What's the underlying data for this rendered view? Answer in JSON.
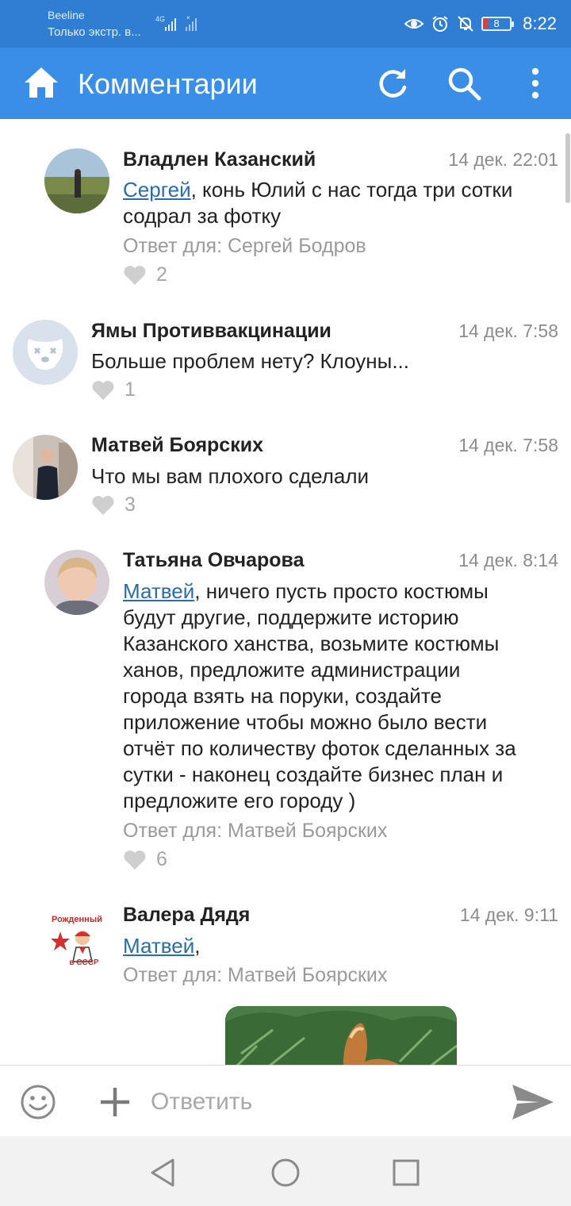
{
  "status_bar": {
    "carrier": "Beeline",
    "carrier_sub": "Только экстр. в...",
    "network_type": "4G",
    "battery": "8",
    "time": "8:22",
    "icons": [
      "eye-icon",
      "alarm-icon",
      "bell-off-icon",
      "battery-icon"
    ]
  },
  "app_bar": {
    "title": "Комментарии",
    "icons": [
      "home-icon",
      "refresh-icon",
      "search-icon",
      "more-icon"
    ],
    "color": "#3a8ee6"
  },
  "comments": [
    {
      "author": "Владлен Казанский",
      "date": "14 дек. 22:01",
      "mention": "Сергей",
      "text_lines": [
        ", конь Юлий с нас тогда три сотки",
        "содрал за фотку"
      ],
      "reply_to": "Ответ для: Сергей Бодров",
      "likes": "2"
    },
    {
      "author": "Ямы Противвакцинации",
      "date": "14 дек. 7:58",
      "text_lines": [
        "Больше проблем нету? Клоуны..."
      ],
      "likes": "1"
    },
    {
      "author": "Матвей Боярских",
      "date": "14 дек. 7:58",
      "text_lines": [
        "Что мы вам плохого сделали"
      ],
      "likes": "3"
    },
    {
      "author": "Татьяна Овчарова",
      "date": "14 дек. 8:14",
      "mention": "Матвей",
      "text_lines": [
        ", ничего пусть просто костюмы",
        "будут другие, поддержите историю",
        "Казанского ханства, возьмите костюмы",
        "ханов, предложите администрации",
        "города взять на поруки, создайте",
        "приложение чтобы можно было вести",
        "отчёт по количеству фоток сделанных за",
        "сутки - наконец создайте бизнес план и",
        "предложите его городу )"
      ],
      "reply_to": "Ответ для: Матвей Боярских",
      "likes": "6"
    },
    {
      "author": "Валера Дядя",
      "date": "14 дек. 9:11",
      "mention": "Матвей",
      "text_lines": [
        ","
      ],
      "reply_to": "Ответ для: Матвей Боярских",
      "avatar_text_top": "Рожденный",
      "avatar_text_bottom": "в СССР"
    }
  ],
  "compose": {
    "placeholder": "Ответить",
    "icons": [
      "emoji-icon",
      "plus-icon",
      "send-icon"
    ]
  },
  "nav_bar": {
    "icons": [
      "back-icon",
      "home-circle-icon",
      "recents-icon"
    ]
  },
  "colors": {
    "status_bar": "#2f7ed3",
    "app_bar": "#3a8ee6",
    "mention": "#2a6ea8",
    "muted": "#9a9a9a"
  }
}
